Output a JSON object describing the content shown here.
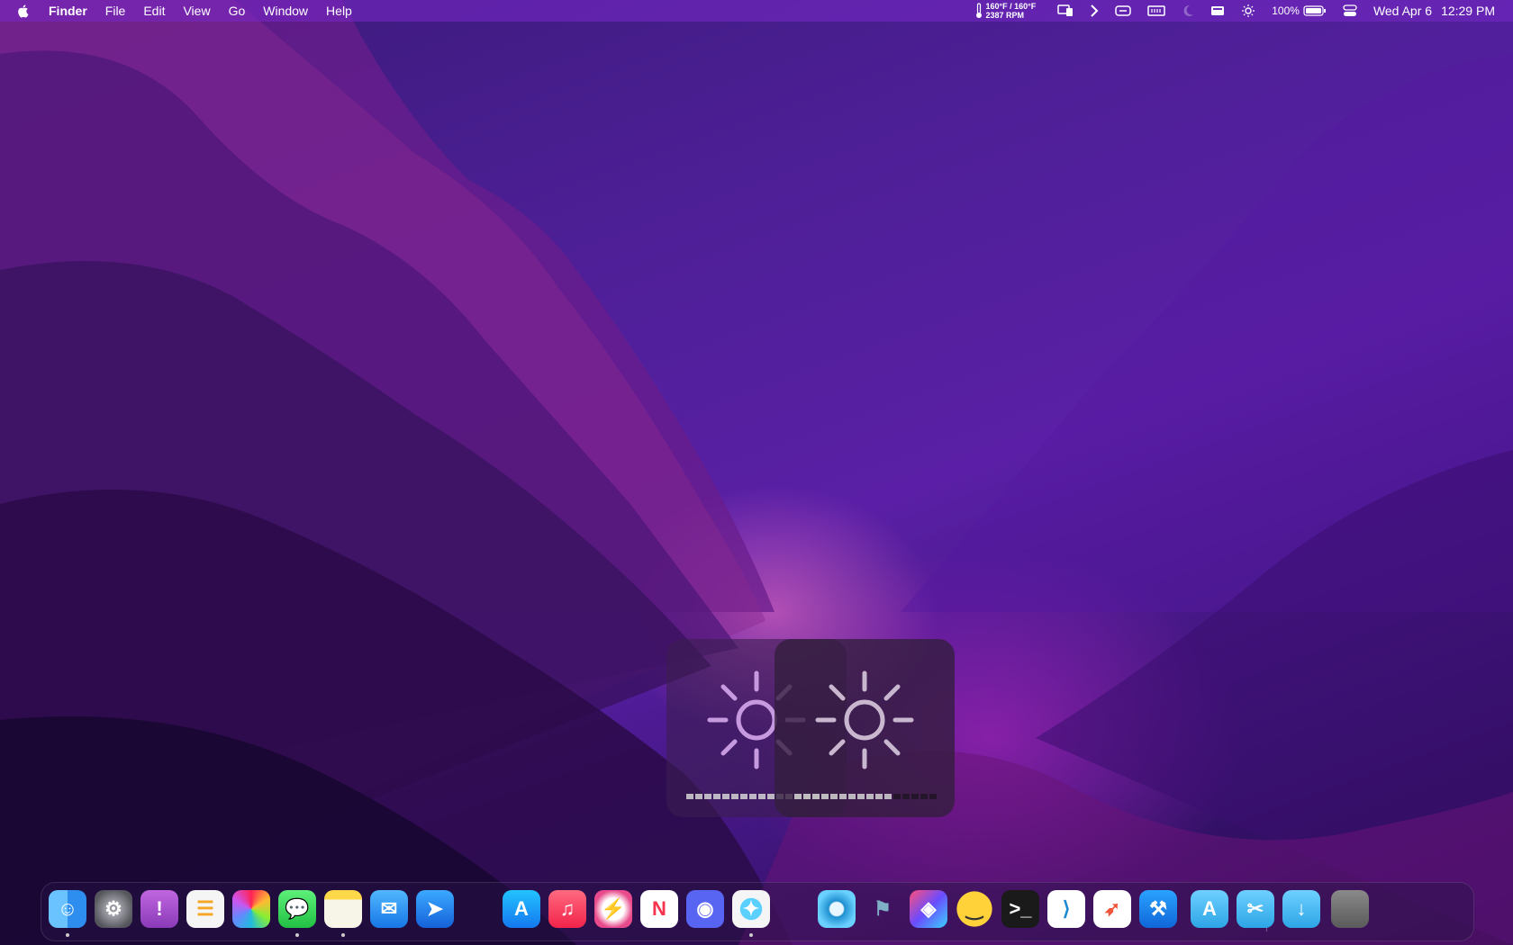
{
  "menubar": {
    "app_name": "Finder",
    "menus": [
      "File",
      "Edit",
      "View",
      "Go",
      "Window",
      "Help"
    ],
    "temperature": "160°F / 160°F",
    "fan_speed": "2387 RPM",
    "battery_percent": "100%",
    "date": "Wed Apr 6",
    "time": "12:29 PM"
  },
  "hud": {
    "brightness_a_level": 1.0,
    "brightness_b_level": 0.69
  },
  "dock": {
    "apps": [
      {
        "name": "Finder",
        "icon": "finder-icon",
        "running": true
      },
      {
        "name": "System Preferences",
        "icon": "gear-icon",
        "running": false
      },
      {
        "name": "Feedback Assistant",
        "icon": "feedback-icon",
        "running": false
      },
      {
        "name": "Reminders",
        "icon": "reminders-icon",
        "running": false
      },
      {
        "name": "Photos",
        "icon": "photos-icon",
        "running": false
      },
      {
        "name": "Messages",
        "icon": "messages-icon",
        "running": true
      },
      {
        "name": "Notes",
        "icon": "notes-icon",
        "running": true
      },
      {
        "name": "Mail",
        "icon": "mail-icon",
        "running": false
      },
      {
        "name": "Spark",
        "icon": "spark-icon",
        "running": false
      },
      {
        "name": "App Store",
        "icon": "appstore-icon",
        "running": false
      },
      {
        "name": "Music",
        "icon": "music-icon",
        "running": false
      },
      {
        "name": "Instruments",
        "icon": "instruments-icon",
        "running": false
      },
      {
        "name": "News",
        "icon": "news-icon",
        "running": false
      },
      {
        "name": "Discord",
        "icon": "discord-icon",
        "running": false
      },
      {
        "name": "Safari",
        "icon": "safari-icon",
        "running": true
      },
      {
        "name": "Disk Utility",
        "icon": "disk-icon",
        "running": false
      },
      {
        "name": "Folder Flag",
        "icon": "flag-icon",
        "running": false
      },
      {
        "name": "Shortcuts",
        "icon": "shortcuts-icon",
        "running": false
      },
      {
        "name": "Emoji",
        "icon": "emoji-icon",
        "running": false
      },
      {
        "name": "Terminal",
        "icon": "terminal-icon",
        "running": false
      },
      {
        "name": "Visual Studio Code",
        "icon": "vscode-icon",
        "running": false
      },
      {
        "name": "Swift Playgrounds",
        "icon": "swift-icon",
        "running": false
      },
      {
        "name": "Xcode",
        "icon": "xcode-icon",
        "running": false
      },
      {
        "name": "Applications",
        "icon": "applications-folder-icon",
        "running": false
      },
      {
        "name": "Utilities",
        "icon": "utilities-folder-icon",
        "running": false
      },
      {
        "name": "Downloads",
        "icon": "downloads-folder-icon",
        "running": false
      },
      {
        "name": "Trash",
        "icon": "trash-icon",
        "running": false
      }
    ]
  }
}
